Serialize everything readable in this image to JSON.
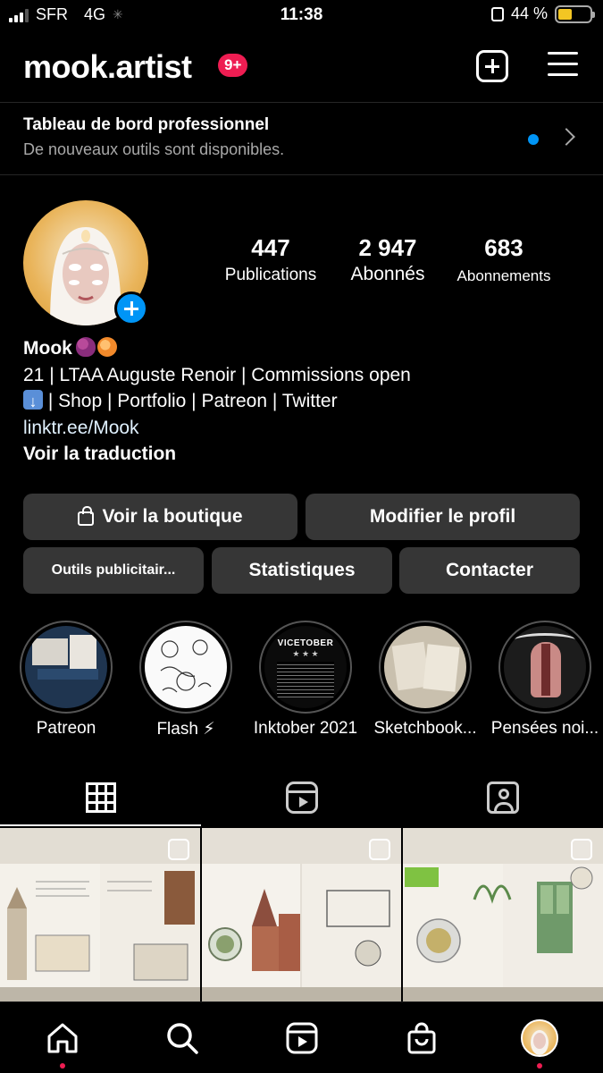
{
  "status_bar": {
    "carrier": "SFR",
    "network": "4G",
    "time": "11:38",
    "battery_percent": "44 %",
    "battery_level": 0.44
  },
  "header": {
    "username": "mook.artist",
    "notification_badge": "9+"
  },
  "dashboard": {
    "title": "Tableau de bord professionnel",
    "subtitle": "De nouveaux outils sont disponibles."
  },
  "profile": {
    "stats": [
      {
        "value": "447",
        "label": "Publications"
      },
      {
        "value": "2 947",
        "label": "Abonnés"
      },
      {
        "value": "683",
        "label": "Abonnements"
      }
    ],
    "name": "Mook",
    "bio_line1": "21 | LTAA Auguste Renoir | Commissions open",
    "bio_line2": " | Shop | Portfolio | Patreon | Twitter",
    "link": "linktr.ee/Mook",
    "translate": "Voir la traduction"
  },
  "buttons": {
    "shop": "Voir la boutique",
    "edit_profile": "Modifier le profil",
    "ad_tools": "Outils publicitair...",
    "stats": "Statistiques",
    "contact": "Contacter"
  },
  "highlights": [
    {
      "label": "Patreon"
    },
    {
      "label": "Flash ⚡"
    },
    {
      "label": "Inktober 2021",
      "inner_title": "VICETOBER"
    },
    {
      "label": "Sketchbook..."
    },
    {
      "label": "Pensées noi..."
    }
  ],
  "colors": {
    "accent_blue": "#0095f6",
    "badge_red": "#ee1d52",
    "button_bg": "#363636"
  }
}
